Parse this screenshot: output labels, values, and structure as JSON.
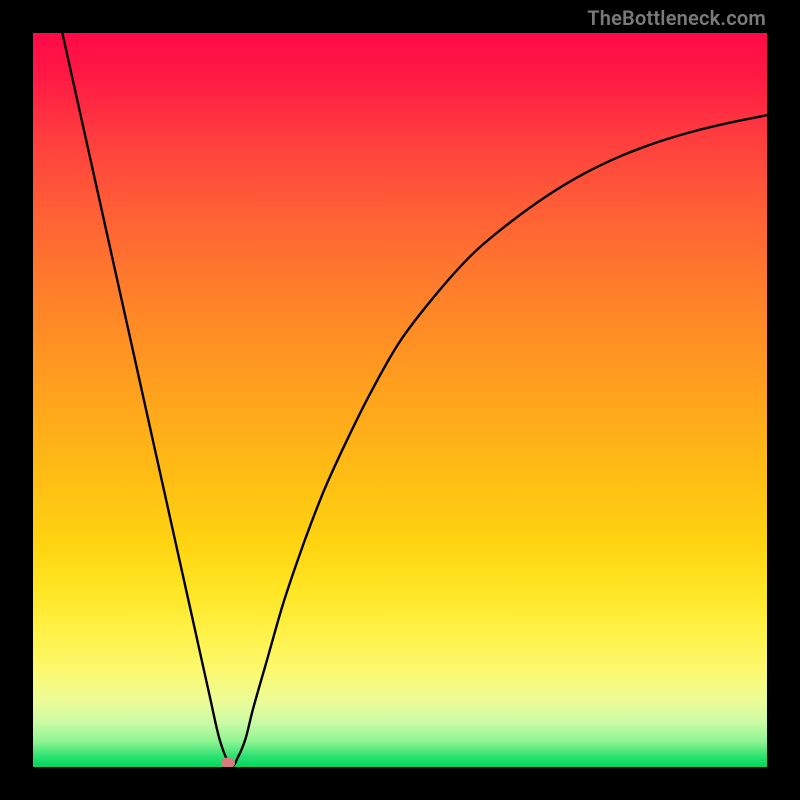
{
  "watermark": "TheBottleneck.com",
  "colors": {
    "frame": "#000000",
    "curve": "#000000",
    "marker": "#d97b7b"
  },
  "chart_data": {
    "type": "line",
    "title": "",
    "xlabel": "",
    "ylabel": "",
    "xlim": [
      0,
      100
    ],
    "ylim": [
      0,
      100
    ],
    "grid": false,
    "series": [
      {
        "name": "curve",
        "x": [
          4,
          6,
          8,
          10,
          12,
          14,
          16,
          18,
          20,
          22,
          24,
          25.5,
          27,
          28,
          29,
          30,
          32,
          34,
          36,
          38,
          40,
          43,
          46,
          50,
          55,
          60,
          65,
          70,
          75,
          80,
          85,
          90,
          95,
          100
        ],
        "y": [
          100,
          91,
          82,
          73,
          64,
          55,
          46,
          37,
          28,
          19,
          10,
          3.5,
          0.2,
          1.5,
          4,
          8,
          15,
          22,
          28,
          33.5,
          38.5,
          45,
          51,
          58,
          64.5,
          70,
          74.2,
          77.8,
          80.8,
          83.2,
          85.1,
          86.6,
          87.8,
          88.8
        ]
      }
    ],
    "marker": {
      "x": 26.5,
      "y": 0.5
    },
    "background_gradient": {
      "direction": "vertical",
      "stops": [
        {
          "pos": 0.0,
          "color": "#ff0a47"
        },
        {
          "pos": 0.5,
          "color": "#ffae19"
        },
        {
          "pos": 0.85,
          "color": "#fff24a"
        },
        {
          "pos": 1.0,
          "color": "#00d65f"
        }
      ]
    }
  }
}
